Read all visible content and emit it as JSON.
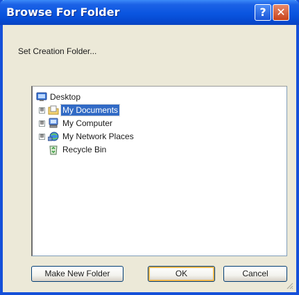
{
  "window": {
    "title": "Browse For Folder"
  },
  "titlebar": {
    "help_glyph": "?",
    "close_glyph": "✕",
    "help_icon": "help-icon",
    "close_icon": "close-icon"
  },
  "dialog": {
    "prompt": "Set Creation Folder..."
  },
  "tree": {
    "root": {
      "label": "Desktop",
      "icon": "desktop-icon"
    },
    "items": [
      {
        "label": "My Documents",
        "icon": "folder-documents-icon",
        "expander": "⊞",
        "selected": true
      },
      {
        "label": "My Computer",
        "icon": "computer-icon",
        "expander": "⊞",
        "selected": false
      },
      {
        "label": "My Network Places",
        "icon": "network-places-icon",
        "expander": "⊞",
        "selected": false
      },
      {
        "label": "Recycle Bin",
        "icon": "recycle-bin-icon",
        "expander": "",
        "selected": false
      }
    ]
  },
  "buttons": {
    "make_new_folder": "Make New Folder",
    "ok": "OK",
    "cancel": "Cancel"
  },
  "colors": {
    "titlebar": "#0a55e0",
    "selection": "#316ac5",
    "dialog_face": "#ece9d8",
    "close_button": "#c8421b"
  }
}
